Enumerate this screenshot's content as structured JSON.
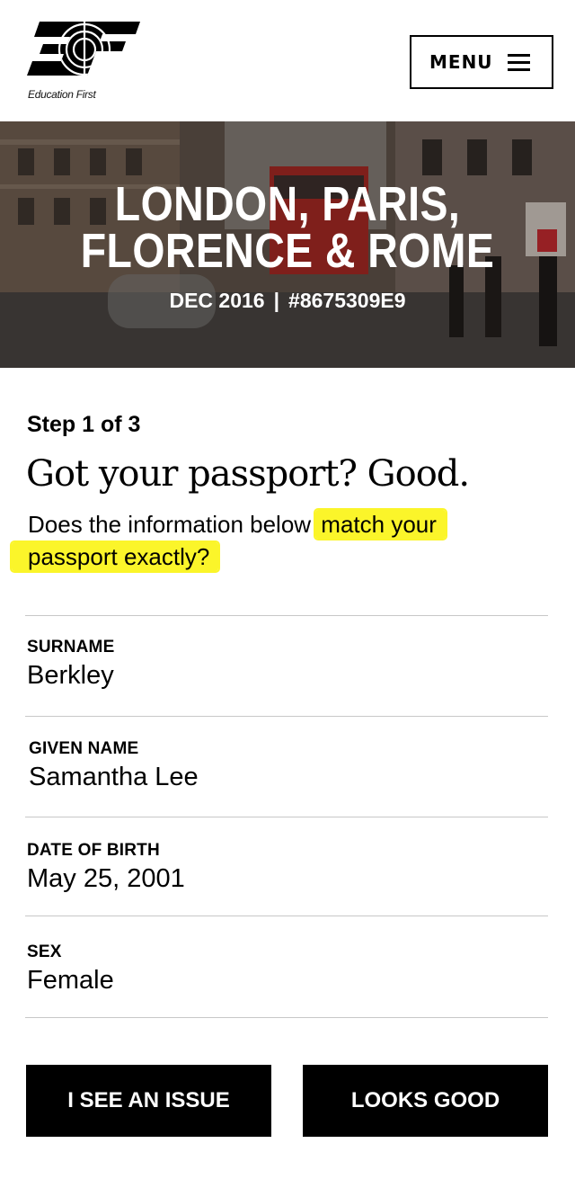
{
  "header": {
    "brand_name": "Education First",
    "menu_label": "MENU"
  },
  "hero": {
    "title_line1": "LONDON, PARIS,",
    "title_line2": "FLORENCE & ROME",
    "date": "DEC 2016",
    "separator": "|",
    "booking_number": "#8675309E9"
  },
  "content": {
    "step": "Step 1 of 3",
    "headline": "Got your passport? Good.",
    "question_prefix": "Does the information below ",
    "question_highlight_1": "match your",
    "question_highlight_2": "passport exactly?"
  },
  "fields": [
    {
      "label": "SURNAME",
      "value": "Berkley"
    },
    {
      "label": "GIVEN NAME",
      "value": "Samantha Lee"
    },
    {
      "label": "DATE OF BIRTH",
      "value": "May 25, 2001"
    },
    {
      "label": "SEX",
      "value": "Female"
    }
  ],
  "actions": {
    "issue_label": "I SEE AN ISSUE",
    "good_label": "LOOKS GOOD"
  },
  "colors": {
    "highlight": "#fbf52a",
    "button_bg": "#000000",
    "button_text": "#ffffff"
  }
}
